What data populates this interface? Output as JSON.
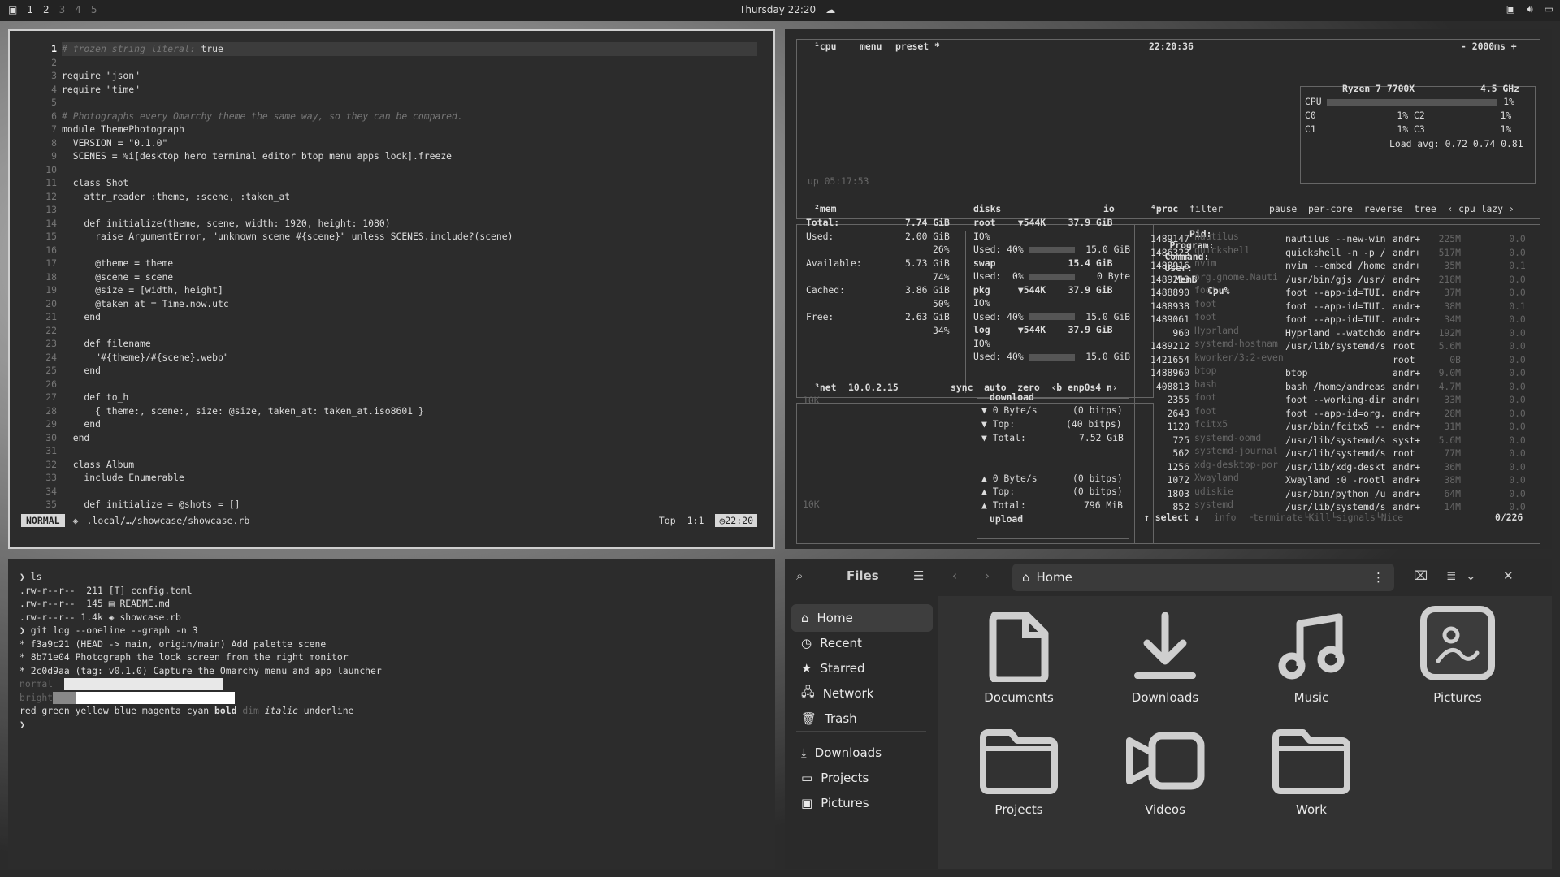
{
  "topbar": {
    "workspaces": [
      "1",
      "2",
      "3",
      "4",
      "5"
    ],
    "clock": "Thursday 22:20"
  },
  "editor": {
    "lines": [
      {
        "n": "1",
        "t": "# frozen_string_literal: true"
      },
      {
        "n": "2",
        "t": ""
      },
      {
        "n": "3",
        "t": "require \"json\""
      },
      {
        "n": "4",
        "t": "require \"time\""
      },
      {
        "n": "5",
        "t": ""
      },
      {
        "n": "6",
        "t": "# Photographs every Omarchy theme the same way, so they can be compared."
      },
      {
        "n": "7",
        "t": "module ThemePhotograph"
      },
      {
        "n": "8",
        "t": "  VERSION = \"0.1.0\""
      },
      {
        "n": "9",
        "t": "  SCENES = %i[desktop hero terminal editor btop menu apps lock].freeze"
      },
      {
        "n": "10",
        "t": ""
      },
      {
        "n": "11",
        "t": "  class Shot"
      },
      {
        "n": "12",
        "t": "    attr_reader :theme, :scene, :taken_at"
      },
      {
        "n": "13",
        "t": ""
      },
      {
        "n": "14",
        "t": "    def initialize(theme, scene, width: 1920, height: 1080)"
      },
      {
        "n": "15",
        "t": "      raise ArgumentError, \"unknown scene #{scene}\" unless SCENES.include?(scene)"
      },
      {
        "n": "16",
        "t": ""
      },
      {
        "n": "17",
        "t": "      @theme = theme"
      },
      {
        "n": "18",
        "t": "      @scene = scene"
      },
      {
        "n": "19",
        "t": "      @size = [width, height]"
      },
      {
        "n": "20",
        "t": "      @taken_at = Time.now.utc"
      },
      {
        "n": "21",
        "t": "    end"
      },
      {
        "n": "22",
        "t": ""
      },
      {
        "n": "23",
        "t": "    def filename"
      },
      {
        "n": "24",
        "t": "      \"#{theme}/#{scene}.webp\""
      },
      {
        "n": "25",
        "t": "    end"
      },
      {
        "n": "26",
        "t": ""
      },
      {
        "n": "27",
        "t": "    def to_h"
      },
      {
        "n": "28",
        "t": "      { theme:, scene:, size: @size, taken_at: taken_at.iso8601 }"
      },
      {
        "n": "29",
        "t": "    end"
      },
      {
        "n": "30",
        "t": "  end"
      },
      {
        "n": "31",
        "t": ""
      },
      {
        "n": "32",
        "t": "  class Album"
      },
      {
        "n": "33",
        "t": "    include Enumerable"
      },
      {
        "n": "34",
        "t": ""
      },
      {
        "n": "35",
        "t": "    def initialize = @shots = []"
      }
    ],
    "status": {
      "mode": "NORMAL",
      "path": ".local/…/showcase/showcase.rb",
      "pos": "Top",
      "cursor": "1:1",
      "time": "22:20"
    }
  },
  "btop": {
    "cpu": {
      "label": "¹cpu",
      "menu": "menu",
      "preset": "preset *",
      "clock": "22:20:36",
      "interval": "- 2000ms +",
      "model": "Ryzen 7 7700X",
      "ghz": "4.5 GHz",
      "uptime": "up 05:17:53",
      "load": "Load avg: 0.72 0.74 0.81",
      "rows": [
        {
          "name": "CPU",
          "val": "1%",
          "fill": 0.01
        },
        {
          "name": "C0",
          "val": "1%",
          "fill": 0.01
        },
        {
          "name": "C2",
          "val": "1%",
          "fill": 0.01
        },
        {
          "name": "C1",
          "val": "1%",
          "fill": 0.01
        },
        {
          "name": "C3",
          "val": "1%",
          "fill": 0.01
        }
      ]
    },
    "mem": {
      "label": "²mem",
      "total_l": "Total:",
      "total": "7.74 GiB",
      "used_l": "Used:",
      "used": "2.00 GiB",
      "used_p": "26%",
      "avail_l": "Available:",
      "avail": "5.73 GiB",
      "avail_p": "74%",
      "cached_l": "Cached:",
      "cached": "3.86 GiB",
      "cached_p": "50%",
      "free_l": "Free:",
      "free": "2.63 GiB",
      "free_p": "34%"
    },
    "disks": {
      "label": "disks",
      "io": "io",
      "items": [
        {
          "name": "root",
          "io": "▼544K",
          "size": "37.9 GiB",
          "io2": "IO%",
          "used": "Used: 40%",
          "usize": "15.0 GiB"
        },
        {
          "name": "swap",
          "io": "",
          "size": "15.4 GiB",
          "io2": "",
          "used": "Used:  0%",
          "usize": "0 Byte"
        },
        {
          "name": "pkg",
          "io": "▼544K",
          "size": "37.9 GiB",
          "io2": "IO%",
          "used": "Used: 40%",
          "usize": "15.0 GiB"
        },
        {
          "name": "log",
          "io": "▼544K",
          "size": "37.9 GiB",
          "io2": "IO%",
          "used": "Used: 40%",
          "usize": "15.0 GiB"
        }
      ]
    },
    "net": {
      "label": "³net",
      "ip": "10.0.2.15",
      "opts": "sync  auto  zero  ‹b enp0s4 n›",
      "scale_top": "10K",
      "scale_bot": "10K",
      "download": "download",
      "upload": "upload",
      "d_rate": "▼ 0 Byte/s",
      "d_rate_b": "(0 bitps)",
      "d_top": "▼ Top:",
      "d_top_b": "(40 bitps)",
      "d_total": "▼ Total:",
      "d_total_v": "7.52 GiB",
      "u_rate": "▲ 0 Byte/s",
      "u_rate_b": "(0 bitps)",
      "u_top": "▲ Top:",
      "u_top_b": "(0 bitps)",
      "u_total": "▲ Total:",
      "u_total_v": "796 MiB"
    },
    "proc": {
      "label": "⁴proc",
      "filter": "filter",
      "opts": "pause  per-core  reverse  tree  ‹ cpu lazy ›",
      "headers": {
        "pid": "Pid:",
        "prog": "Program:",
        "cmd": "Command:",
        "user": "User:",
        "mem": "MemB",
        "cpu": "Cpu%"
      },
      "rows": [
        {
          "pid": "1489147",
          "prog": "nautilus",
          "cmd": "nautilus --new-win",
          "user": "andr+",
          "mem": "225M",
          "cpu": "0.0"
        },
        {
          "pid": "1486323",
          "prog": "quickshell",
          "cmd": "quickshell -n -p /",
          "user": "andr+",
          "mem": "517M",
          "cpu": "0.0"
        },
        {
          "pid": "1488916",
          "prog": "nvim",
          "cmd": "nvim --embed /home",
          "user": "andr+",
          "mem": "35M",
          "cpu": "0.1"
        },
        {
          "pid": "1489213",
          "prog": "org.gnome.Nauti",
          "cmd": "/usr/bin/gjs /usr/",
          "user": "andr+",
          "mem": "218M",
          "cpu": "0.0"
        },
        {
          "pid": "1488890",
          "prog": "foot",
          "cmd": "foot --app-id=TUI.",
          "user": "andr+",
          "mem": "37M",
          "cpu": "0.0"
        },
        {
          "pid": "1488938",
          "prog": "foot",
          "cmd": "foot --app-id=TUI.",
          "user": "andr+",
          "mem": "38M",
          "cpu": "0.1"
        },
        {
          "pid": "1489061",
          "prog": "foot",
          "cmd": "foot --app-id=TUI.",
          "user": "andr+",
          "mem": "34M",
          "cpu": "0.0"
        },
        {
          "pid": "960",
          "prog": "Hyprland",
          "cmd": "Hyprland --watchdo",
          "user": "andr+",
          "mem": "192M",
          "cpu": "0.0"
        },
        {
          "pid": "1489212",
          "prog": "systemd-hostnam",
          "cmd": "/usr/lib/systemd/s",
          "user": "root",
          "mem": "5.6M",
          "cpu": "0.0"
        },
        {
          "pid": "1421654",
          "prog": "kworker/3:2-even",
          "cmd": "",
          "user": "root",
          "mem": "0B",
          "cpu": "0.0"
        },
        {
          "pid": "1488960",
          "prog": "btop",
          "cmd": "btop",
          "user": "andr+",
          "mem": "9.0M",
          "cpu": "0.0"
        },
        {
          "pid": "408813",
          "prog": "bash",
          "cmd": "bash /home/andreas",
          "user": "andr+",
          "mem": "4.7M",
          "cpu": "0.0"
        },
        {
          "pid": "2355",
          "prog": "foot",
          "cmd": "foot --working-dir",
          "user": "andr+",
          "mem": "33M",
          "cpu": "0.0"
        },
        {
          "pid": "2643",
          "prog": "foot",
          "cmd": "foot --app-id=org.",
          "user": "andr+",
          "mem": "28M",
          "cpu": "0.0"
        },
        {
          "pid": "1120",
          "prog": "fcitx5",
          "cmd": "/usr/bin/fcitx5 --",
          "user": "andr+",
          "mem": "31M",
          "cpu": "0.0"
        },
        {
          "pid": "725",
          "prog": "systemd-oomd",
          "cmd": "/usr/lib/systemd/s",
          "user": "syst+",
          "mem": "5.6M",
          "cpu": "0.0"
        },
        {
          "pid": "562",
          "prog": "systemd-journal",
          "cmd": "/usr/lib/systemd/s",
          "user": "root",
          "mem": "77M",
          "cpu": "0.0"
        },
        {
          "pid": "1256",
          "prog": "xdg-desktop-por",
          "cmd": "/usr/lib/xdg-deskt",
          "user": "andr+",
          "mem": "36M",
          "cpu": "0.0"
        },
        {
          "pid": "1072",
          "prog": "Xwayland",
          "cmd": "Xwayland :0 -rootl",
          "user": "andr+",
          "mem": "38M",
          "cpu": "0.0"
        },
        {
          "pid": "1803",
          "prog": "udiskie",
          "cmd": "/usr/bin/python /u",
          "user": "andr+",
          "mem": "64M",
          "cpu": "0.0"
        },
        {
          "pid": "852",
          "prog": "systemd",
          "cmd": "/usr/lib/systemd/s",
          "user": "andr+",
          "mem": "14M",
          "cpu": "0.0"
        }
      ],
      "footer": "↑ select ↓",
      "footer_opts": "info  └terminate└Kill└signals└Nice",
      "count": "0/226"
    }
  },
  "terminal": {
    "lines": [
      "❯ ls",
      ".rw-r--r--  211 [T] config.toml",
      ".rw-r--r--  145 ▤ README.md",
      ".rw-r--r-- 1.4k ◈ showcase.rb",
      "❯ git log --oneline --graph -n 3",
      "* f3a9c21 (HEAD -> main, origin/main) Add palette scene",
      "* 8b71e04 Photograph the lock screen from the right monitor",
      "* 2c0d9aa (tag: v0.1.0) Capture the Omarchy menu and app launcher"
    ],
    "normal": "normal",
    "bright": "bright",
    "styles": {
      "colors": "red green yellow blue magenta cyan",
      "bold": "bold",
      "dim": "dim",
      "italic": "italic",
      "underline": "underline"
    },
    "prompt": "❯"
  },
  "files": {
    "title": "Files",
    "location": "Home",
    "sidebar": [
      {
        "label": "Home",
        "icon": "home-icon"
      },
      {
        "label": "Recent",
        "icon": "clock-icon"
      },
      {
        "label": "Starred",
        "icon": "star-icon"
      },
      {
        "label": "Network",
        "icon": "network-icon"
      },
      {
        "label": "Trash",
        "icon": "trash-icon"
      },
      {
        "label": "Downloads",
        "icon": "download-icon"
      },
      {
        "label": "Projects",
        "icon": "folder-icon"
      },
      {
        "label": "Pictures",
        "icon": "picture-icon"
      }
    ],
    "items": [
      {
        "label": "Documents",
        "icon": "document-icon"
      },
      {
        "label": "Downloads",
        "icon": "download-icon"
      },
      {
        "label": "Music",
        "icon": "music-icon"
      },
      {
        "label": "Pictures",
        "icon": "picture-icon"
      },
      {
        "label": "Projects",
        "icon": "folder-icon"
      },
      {
        "label": "Videos",
        "icon": "video-icon"
      },
      {
        "label": "Work",
        "icon": "folder-icon"
      }
    ]
  }
}
